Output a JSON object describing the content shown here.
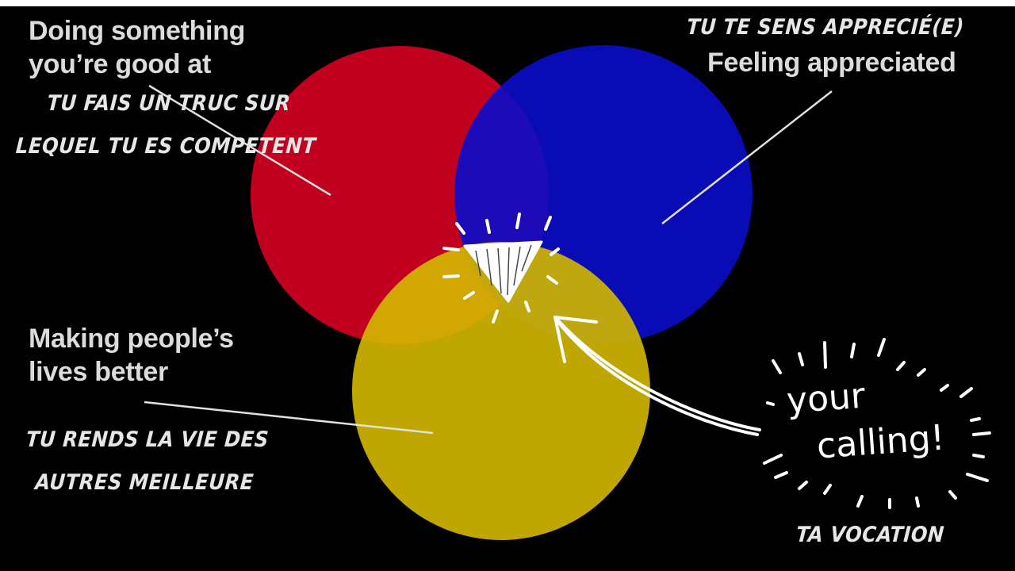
{
  "diagram": {
    "colors": {
      "background": "#000000",
      "red_circle": "#c0001e",
      "blue_circle": "#0a0cc8",
      "yellow_circle": "#d4b800",
      "text": "#dcdcdc",
      "annotation": "#ffffff"
    },
    "circles": [
      {
        "id": "red",
        "label": "Doing something\nyou’re good at",
        "translation": "TU FAIS UN TRUC SUR\nLEQUEL TU ES COMPETENT"
      },
      {
        "id": "blue",
        "label": "Feeling appreciated",
        "translation": "TU TE SENS APPRECIÉ(E)"
      },
      {
        "id": "yellow",
        "label": "Making people’s\nlives better",
        "translation": "TU RENDS LA VIE DES\nAUTRES MEILLEURE"
      }
    ],
    "center": {
      "annotation_line1": "your",
      "annotation_line2": "calling!",
      "translation": "TA VOCATION",
      "icon": "gem-icon"
    }
  }
}
